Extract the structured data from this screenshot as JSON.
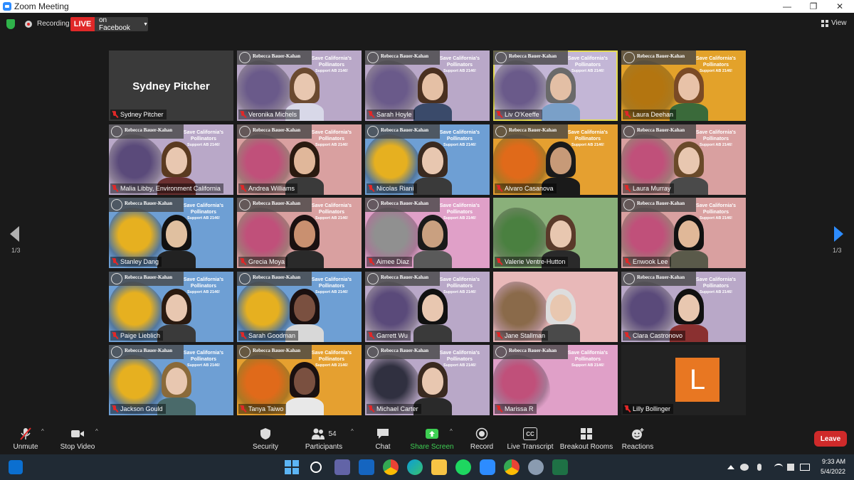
{
  "window": {
    "title": "Zoom Meeting"
  },
  "status": {
    "recording_label": "Recording",
    "live_label": "LIVE",
    "stream_target": "on Facebook",
    "view_label": "View"
  },
  "banner": {
    "rep_name": "Rebecca Bauer-Kahan",
    "line1": "Save California's",
    "line2": "Pollinators",
    "line3": "Support AB 2146!"
  },
  "participants": [
    {
      "name": "Sydney Pitcher",
      "display": "Sydney Pitcher"
    },
    {
      "name": "Veronika Michels"
    },
    {
      "name": "Sarah Hoyle"
    },
    {
      "name": "Liv O'Keeffe",
      "active": true
    },
    {
      "name": "Laura Deehan"
    },
    {
      "name": "Malia Libby, Environment California"
    },
    {
      "name": "Andrea Williams"
    },
    {
      "name": "Nicolas Riani"
    },
    {
      "name": "Alvaro Casanova"
    },
    {
      "name": "Laura Murray"
    },
    {
      "name": "Stanley Dang"
    },
    {
      "name": "Grecia Moya"
    },
    {
      "name": "Aimee Diaz"
    },
    {
      "name": "Valerie Ventre-Hutton"
    },
    {
      "name": "Enwook Lee"
    },
    {
      "name": "Paige Lieblich"
    },
    {
      "name": "Sarah Goodman"
    },
    {
      "name": "Garrett Wu"
    },
    {
      "name": "Jane Stallman"
    },
    {
      "name": "Clara Castronovo"
    },
    {
      "name": "Jackson Gould"
    },
    {
      "name": "Tanya Taiwo"
    },
    {
      "name": "Michael Carter"
    },
    {
      "name": "Marissa R"
    },
    {
      "name": "Lilly Bollinger",
      "initial": "L"
    }
  ],
  "pagination": {
    "left": "1/3",
    "right": "1/3"
  },
  "toolbar": {
    "unmute": "Unmute",
    "stop_video": "Stop Video",
    "security": "Security",
    "participants": "Participants",
    "participants_count": "54",
    "chat": "Chat",
    "share_screen": "Share Screen",
    "record": "Record",
    "live_transcript": "Live Transcript",
    "cc": "CC",
    "breakout_rooms": "Breakout Rooms",
    "reactions": "Reactions",
    "leave": "Leave"
  },
  "taskbar": {
    "time": "9:33 AM",
    "date": "5/4/2022"
  },
  "colors": {
    "accent_blue": "#2d8cff",
    "live_red": "#e02828",
    "share_green": "#3ecf53",
    "leave_red": "#cf2a2a",
    "active_speaker": "#e6dc50"
  }
}
